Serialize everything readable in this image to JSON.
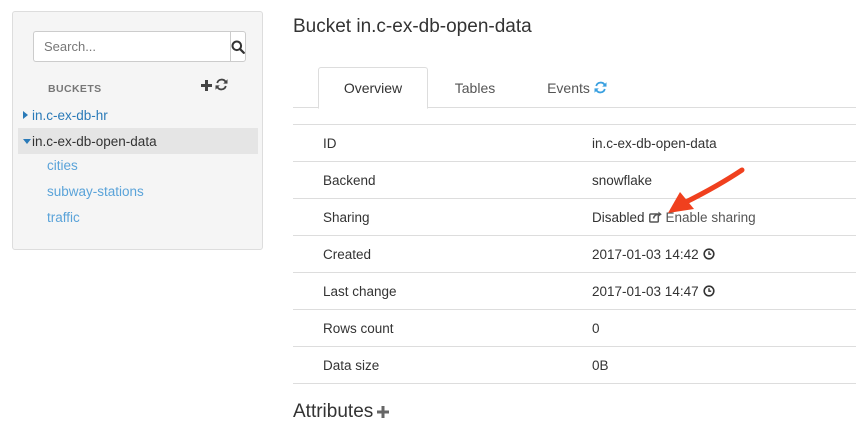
{
  "sidebar": {
    "search_placeholder": "Search...",
    "buckets_header": "BUCKETS",
    "buckets": [
      {
        "name": "in.c-ex-db-hr",
        "expanded": false
      },
      {
        "name": "in.c-ex-db-open-data",
        "expanded": true
      }
    ],
    "tables": [
      "cities",
      "subway-stations",
      "traffic"
    ]
  },
  "main": {
    "title": "Bucket in.c-ex-db-open-data",
    "tabs": [
      {
        "label": "Overview",
        "active": true
      },
      {
        "label": "Tables",
        "active": false
      },
      {
        "label": "Events",
        "active": false
      }
    ],
    "details": [
      {
        "label": "ID",
        "value": "in.c-ex-db-open-data"
      },
      {
        "label": "Backend",
        "value": "snowflake"
      },
      {
        "label": "Sharing",
        "value": "Disabled",
        "action": "Enable sharing"
      },
      {
        "label": "Created",
        "value": "2017-01-03 14:42"
      },
      {
        "label": "Last change",
        "value": "2017-01-03 14:47"
      },
      {
        "label": "Rows count",
        "value": "0"
      },
      {
        "label": "Data size",
        "value": "0B"
      }
    ],
    "attributes_title": "Attributes"
  },
  "colors": {
    "link": "#2a7ab8",
    "link_light": "#5aa3d9",
    "refresh_accent": "#3aa0e0",
    "annotation_arrow": "#f0401e"
  }
}
